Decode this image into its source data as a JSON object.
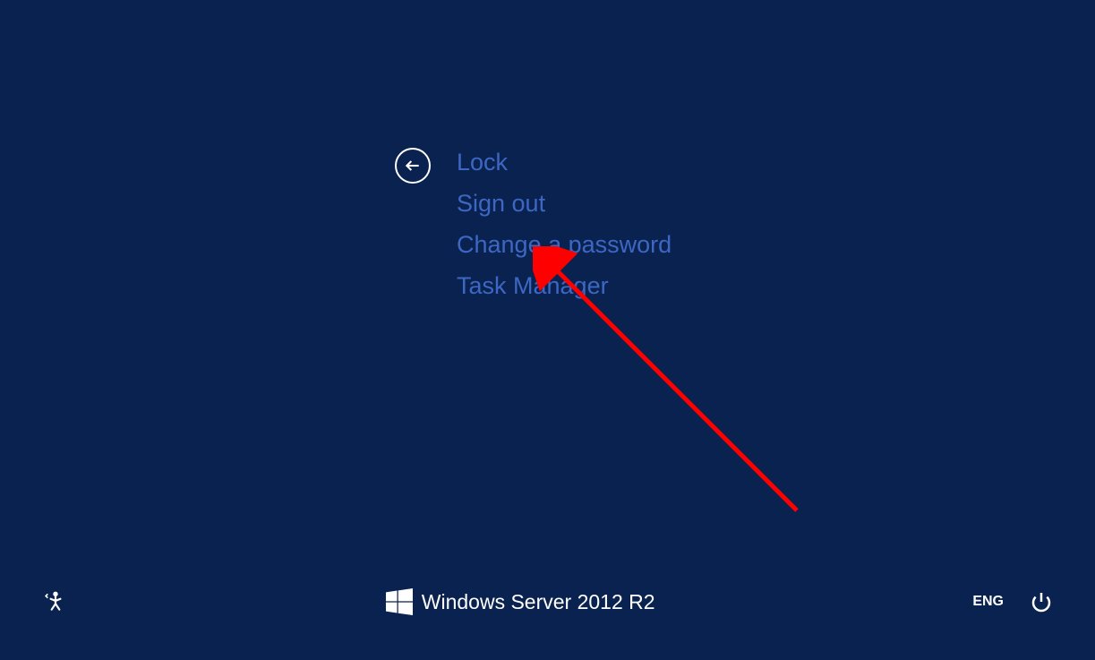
{
  "options": {
    "lock": "Lock",
    "signout": "Sign out",
    "changepassword": "Change a password",
    "taskmanager": "Task Manager"
  },
  "branding": {
    "text": "Windows Server 2012 R2"
  },
  "footer": {
    "language": "ENG"
  }
}
